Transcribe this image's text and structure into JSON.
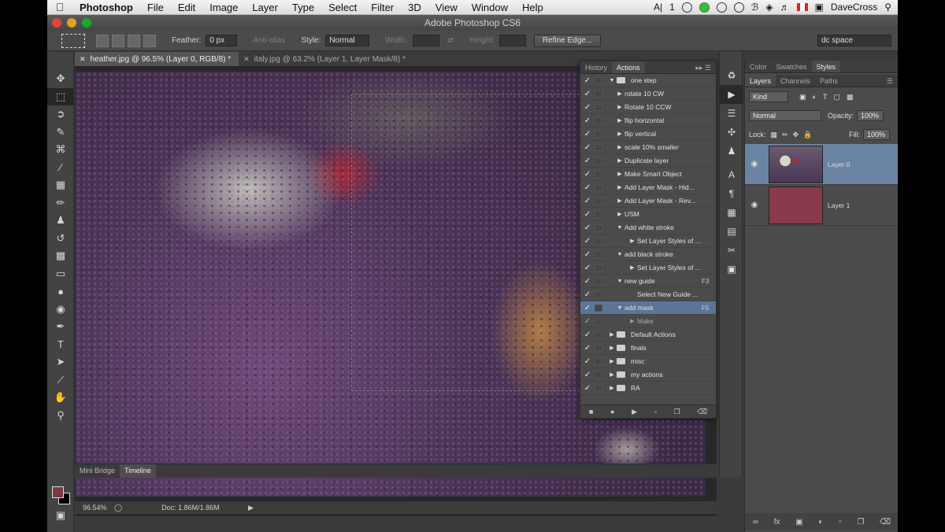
{
  "menubar": {
    "app": "Photoshop",
    "items": [
      "File",
      "Edit",
      "Image",
      "Layer",
      "Type",
      "Select",
      "Filter",
      "3D",
      "View",
      "Window",
      "Help"
    ],
    "user": "DaveCross",
    "status_num": "1"
  },
  "window": {
    "title": "Adobe Photoshop CS6"
  },
  "options": {
    "feather_label": "Feather:",
    "feather_value": "0 px",
    "antialias_label": "Anti-alias",
    "style_label": "Style:",
    "style_value": "Normal",
    "width_label": "Width:",
    "height_label": "Height:",
    "refine_edge": "Refine Edge...",
    "workspace": "dc space"
  },
  "tabs": [
    {
      "label": "heather.jpg @ 96.5% (Layer 0, RGB/8) *"
    },
    {
      "label": "italy.jpg @ 63.2% (Layer 1, Layer Mask/8) *"
    }
  ],
  "status": {
    "zoom": "96.54%",
    "doc": "Doc: 1.86M/1.86M"
  },
  "bottom_tabs": [
    "Mini Bridge",
    "Timeline"
  ],
  "actions_panel": {
    "tabs": [
      "History",
      "Actions"
    ],
    "rows": [
      {
        "label": "one step",
        "key": ""
      },
      {
        "label": "rotate 10 CW",
        "key": ""
      },
      {
        "label": "Rotate 10 CCW",
        "key": ""
      },
      {
        "label": "flip horizontal",
        "key": ""
      },
      {
        "label": "flip vertical",
        "key": ""
      },
      {
        "label": "scale 10% smaller",
        "key": ""
      },
      {
        "label": "Duplicate layer",
        "key": ""
      },
      {
        "label": "Make Smart Object",
        "key": ""
      },
      {
        "label": "Add Layer Mask - Hid...",
        "key": ""
      },
      {
        "label": "Add Layer Mask - Rev...",
        "key": ""
      },
      {
        "label": "USM",
        "key": ""
      },
      {
        "label": "Add white stroke",
        "key": ""
      },
      {
        "label": "Set Layer Styles of ...",
        "key": ""
      },
      {
        "label": "add black stroke",
        "key": ""
      },
      {
        "label": "Set Layer Styles of ...",
        "key": ""
      },
      {
        "label": "new guide",
        "key": "F3"
      },
      {
        "label": "Select New Guide ...",
        "key": ""
      },
      {
        "label": "add mask",
        "key": "F5"
      },
      {
        "label": "Make",
        "key": ""
      },
      {
        "label": "Default Actions",
        "key": ""
      },
      {
        "label": "finals",
        "key": ""
      },
      {
        "label": "misc",
        "key": ""
      },
      {
        "label": "my actions",
        "key": ""
      },
      {
        "label": "RA",
        "key": ""
      }
    ]
  },
  "layers_panel": {
    "top_tabs": [
      "Color",
      "Swatches",
      "Styles"
    ],
    "tabs": [
      "Layers",
      "Channels",
      "Paths"
    ],
    "kind": "Kind",
    "blend_mode": "Normal",
    "opacity_label": "Opacity:",
    "opacity": "100%",
    "lock_label": "Lock:",
    "fill_label": "Fill:",
    "fill": "100%",
    "layers": [
      {
        "name": "Layer 0",
        "selected": true
      },
      {
        "name": "Layer 1",
        "selected": false,
        "color": "#8a3a4a"
      }
    ]
  },
  "colors": {
    "foreground": "#7a3a46",
    "background": "#000000",
    "selection": "#5c7596"
  }
}
